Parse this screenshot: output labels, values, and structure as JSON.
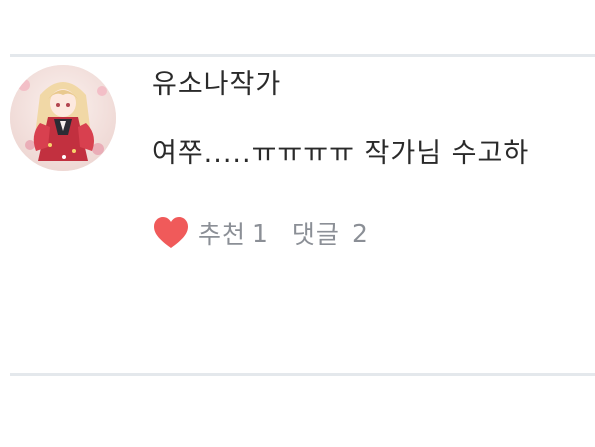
{
  "comment": {
    "author": "유소나작가",
    "text": "여쭈.....ㅠㅠㅠㅠ 작가님 수고하",
    "like": {
      "icon": "heart-icon",
      "label": "추천",
      "count": "1",
      "color": "#f05a5a"
    },
    "reply": {
      "label": "댓글",
      "count": "2"
    },
    "avatar": {
      "icon": "anime-girl-avatar"
    }
  },
  "colors": {
    "divider": "#e4e8ec",
    "text": "#2a2a2a",
    "muted": "#8b8f96"
  }
}
